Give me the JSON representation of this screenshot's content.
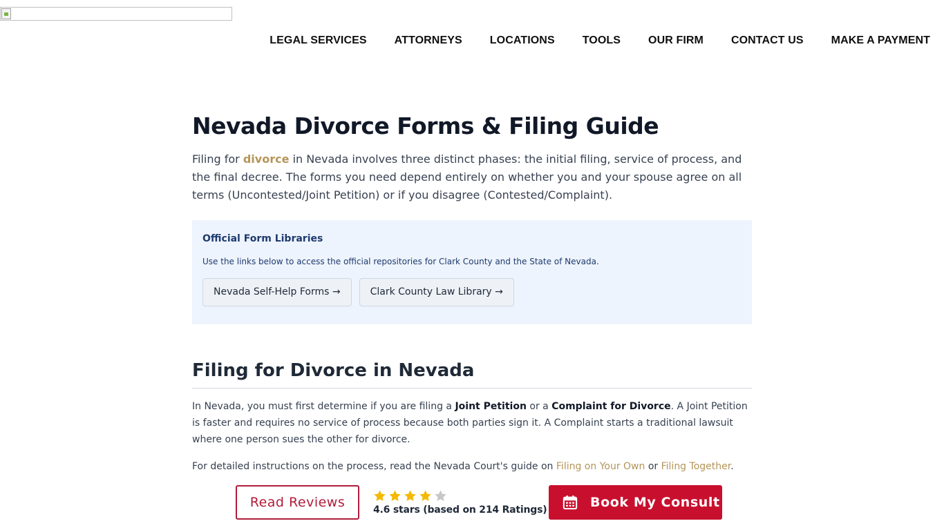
{
  "header": {
    "nav": [
      {
        "label": "LEGAL SERVICES"
      },
      {
        "label": "ATTORNEYS"
      },
      {
        "label": "LOCATIONS"
      },
      {
        "label": "TOOLS"
      },
      {
        "label": "OUR FIRM"
      },
      {
        "label": "CONTACT US"
      },
      {
        "label": "MAKE A PAYMENT"
      }
    ]
  },
  "main": {
    "title": "Nevada Divorce Forms & Filing Guide",
    "intro": {
      "before": "Filing for ",
      "link": "divorce",
      "after": " in Nevada involves three distinct phases: the initial filing, service of process, and the final decree. The forms you need depend entirely on whether you and your spouse agree on all terms (Uncontested/Joint Petition) or if you disagree (Contested/Complaint)."
    },
    "libraries": {
      "heading": "Official Form Libraries",
      "description": "Use the links below to access the official repositories for Clark County and the State of Nevada.",
      "buttons": [
        {
          "label": "Nevada Self-Help Forms →"
        },
        {
          "label": "Clark County Law Library →"
        }
      ]
    },
    "section": {
      "title": "Filing for Divorce in Nevada",
      "p1": {
        "t1": "In Nevada, you must first determine if you are filing a ",
        "b1": "Joint Petition",
        "t2": " or a ",
        "b2": "Complaint for Divorce",
        "t3": ". A Joint Petition is faster and requires no service of process because both parties sign it. A Complaint starts a traditional lawsuit where one person sues the other for divorce."
      },
      "p2": {
        "t1": "For detailed instructions on the process, read the Nevada Court's guide on ",
        "link1": "Filing on Your Own",
        "t2": " or ",
        "link2": "Filing Together",
        "t3": "."
      }
    }
  },
  "bottom_bar": {
    "reviews_label": "Read Reviews",
    "rating": 4.6,
    "stars_filled": 4,
    "stars_total": 5,
    "rating_text": "4.6 stars (based on 214 Ratings)",
    "consult_label": "Book My Consult",
    "icons": {
      "consult": "calendar-icon",
      "star": "star-icon"
    }
  },
  "colors": {
    "accent_gold": "#b59558",
    "brand_red": "#c8102e",
    "panel_bg": "#eef4fd",
    "star_filled": "#f5b800",
    "star_empty": "#c7c7c7"
  }
}
